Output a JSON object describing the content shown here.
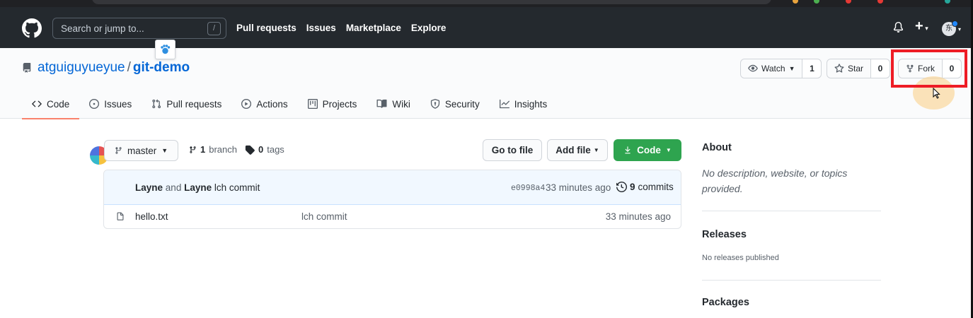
{
  "header": {
    "search_placeholder": "Search or jump to...",
    "search_key": "/",
    "nav": [
      "Pull requests",
      "Issues",
      "Marketplace",
      "Explore"
    ],
    "avatar_initial": "东"
  },
  "repo": {
    "owner": "atguiguyueyue",
    "separator": "/",
    "name": "git-demo",
    "watch_label": "Watch",
    "watch_count": "1",
    "star_label": "Star",
    "star_count": "0",
    "fork_label": "Fork",
    "fork_count": "0"
  },
  "tabs": [
    "Code",
    "Issues",
    "Pull requests",
    "Actions",
    "Projects",
    "Wiki",
    "Security",
    "Insights"
  ],
  "toolbar": {
    "branch": "master",
    "branch_count": "1",
    "branch_word": "branch",
    "tag_count": "0",
    "tag_word": "tags",
    "go_to_file": "Go to file",
    "add_file": "Add file",
    "code": "Code"
  },
  "commit": {
    "author1": "Layne",
    "and": "and",
    "author2": "Layne",
    "message": "lch commit",
    "sha": "e0998a4",
    "time": "33 minutes ago",
    "count": "9",
    "count_word": "commits"
  },
  "files": [
    {
      "name": "hello.txt",
      "message": "lch commit",
      "time": "33 minutes ago"
    }
  ],
  "sidebar": {
    "about_title": "About",
    "about_desc": "No description, website, or topics provided.",
    "releases_title": "Releases",
    "releases_desc": "No releases published",
    "packages_title": "Packages"
  },
  "colors": {
    "header_bg": "#24292e",
    "link": "#0366d6",
    "primary_green": "#2ea44f",
    "highlight_red": "#ee1c25",
    "active_tab": "#f9826c"
  }
}
